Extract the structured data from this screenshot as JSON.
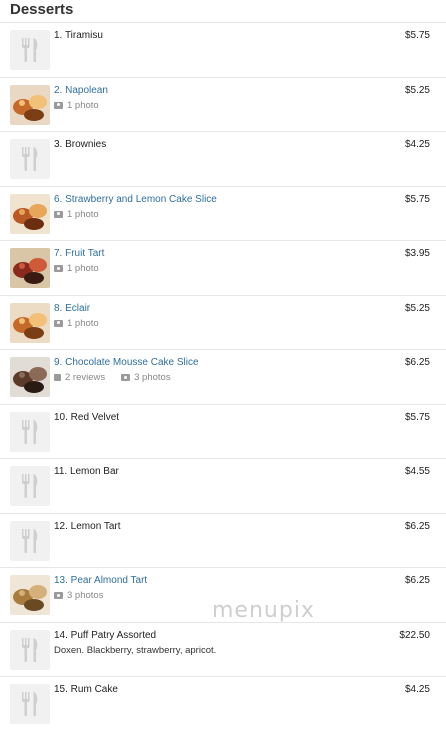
{
  "section": {
    "title": "Desserts"
  },
  "items": [
    {
      "name": "1. Tiramisu",
      "price": "$5.75",
      "image": "placeholder-icon",
      "linked": false,
      "sub": []
    },
    {
      "name": "2. Napolean",
      "price": "$5.25",
      "image": "food-photo",
      "linked": true,
      "sub": [
        {
          "icon": "camera-icon",
          "text": "1 photo"
        }
      ]
    },
    {
      "name": "3. Brownies",
      "price": "$4.25",
      "image": "placeholder-icon",
      "linked": false,
      "sub": []
    },
    {
      "name": "6. Strawberry and Lemon Cake Slice",
      "price": "$5.75",
      "image": "food-photo",
      "linked": true,
      "sub": [
        {
          "icon": "camera-icon",
          "text": "1 photo"
        }
      ]
    },
    {
      "name": "7. Fruit Tart",
      "price": "$3.95",
      "image": "food-photo",
      "linked": true,
      "sub": [
        {
          "icon": "camera-icon",
          "text": "1 photo"
        }
      ]
    },
    {
      "name": "8. Eclair",
      "price": "$5.25",
      "image": "food-photo",
      "linked": true,
      "sub": [
        {
          "icon": "camera-icon",
          "text": "1 photo"
        }
      ]
    },
    {
      "name": "9. Chocolate Mousse Cake Slice",
      "price": "$6.25",
      "image": "food-photo",
      "linked": true,
      "sub": [
        {
          "icon": "review-icon",
          "text": "2 reviews"
        },
        {
          "icon": "camera-icon",
          "text": "3 photos"
        }
      ]
    },
    {
      "name": "10. Red Velvet",
      "price": "$5.75",
      "image": "placeholder-icon",
      "linked": false,
      "sub": []
    },
    {
      "name": "11. Lemon Bar",
      "price": "$4.55",
      "image": "placeholder-icon",
      "linked": false,
      "sub": []
    },
    {
      "name": "12. Lemon Tart",
      "price": "$6.25",
      "image": "placeholder-icon",
      "linked": false,
      "sub": []
    },
    {
      "name": "13. Pear Almond Tart",
      "price": "$6.25",
      "image": "food-photo",
      "linked": true,
      "sub": [
        {
          "icon": "camera-icon",
          "text": "3 photos"
        }
      ]
    },
    {
      "name": "14. Puff Patry Assorted",
      "price": "$22.50",
      "image": "placeholder-icon",
      "linked": false,
      "description": "Doxen. Blackberry, strawberry, apricot.",
      "sub": []
    },
    {
      "name": "15. Rum Cake",
      "price": "$4.25",
      "image": "placeholder-icon",
      "linked": false,
      "sub": []
    }
  ],
  "watermark": "menupix",
  "colors": {
    "link": "#2f6f9f",
    "text": "#222222",
    "muted": "#888888",
    "divider": "#e6e6e6"
  }
}
